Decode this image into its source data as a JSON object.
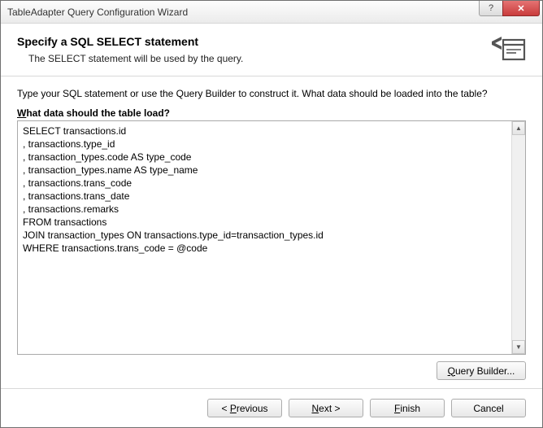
{
  "titlebar": {
    "title": "TableAdapter Query Configuration Wizard",
    "help": "?",
    "close": "✕"
  },
  "header": {
    "title": "Specify a SQL SELECT statement",
    "subtitle": "The SELECT statement will be used by the query."
  },
  "body": {
    "instruction": "Type your SQL statement or use the Query Builder to construct it. What data should be loaded into the table?",
    "label_prefix_underlined": "W",
    "label_rest": "hat data should the table load?",
    "sql": "SELECT transactions.id\n, transactions.type_id\n, transaction_types.code AS type_code\n, transaction_types.name AS type_name\n, transactions.trans_code\n, transactions.trans_date\n, transactions.remarks\nFROM transactions\nJOIN transaction_types ON transactions.type_id=transaction_types.id\nWHERE transactions.trans_code = @code",
    "query_builder_u": "Q",
    "query_builder_rest": "uery Builder..."
  },
  "footer": {
    "previous_pre": "< ",
    "previous_u": "P",
    "previous_rest": "revious",
    "next_u": "N",
    "next_rest": "ext >",
    "finish_u": "F",
    "finish_rest": "inish",
    "cancel": "Cancel"
  }
}
